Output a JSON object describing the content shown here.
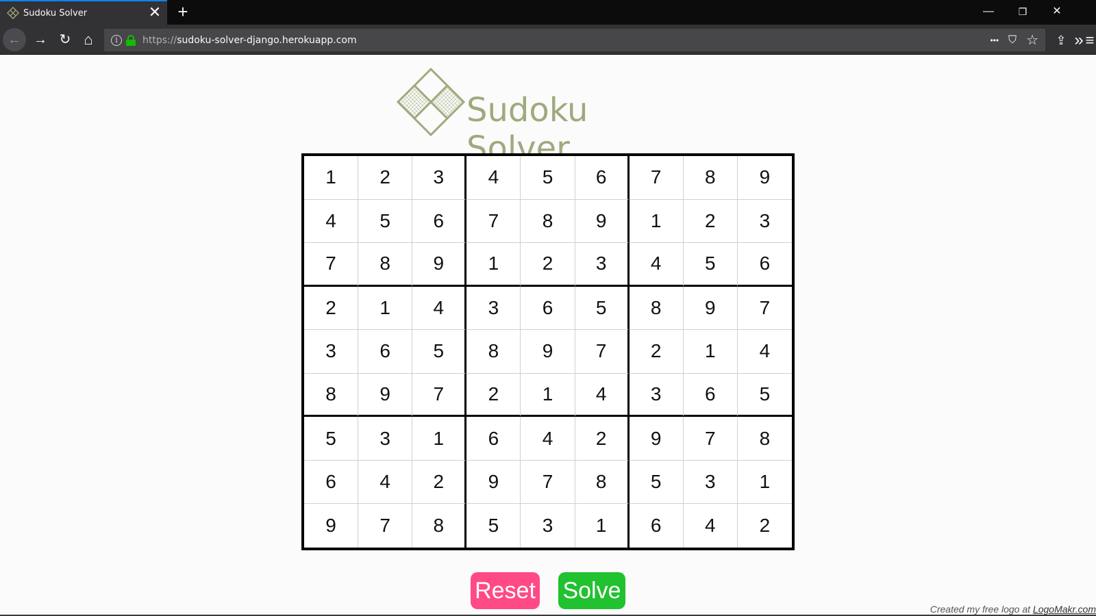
{
  "browser": {
    "tab_title": "Sudoku Solver",
    "tab_close": "✕",
    "new_tab": "+",
    "url_prefix": "https://",
    "url_host": "sudoku-solver-django.herokuapp.com",
    "window_controls": {
      "minimize": "—",
      "restore": "❐",
      "close": "✕"
    },
    "nav": {
      "back": "←",
      "forward": "→",
      "reload": "↻",
      "home": "⌂"
    },
    "url_icons": {
      "more": "•••",
      "pocket": "⛉",
      "bookmark": "☆"
    },
    "toolbar": {
      "library": "⇪",
      "overflow": "»",
      "menu": "≡"
    }
  },
  "page": {
    "logo_text": "Sudoku Solver",
    "grid": [
      [
        "1",
        "2",
        "3",
        "4",
        "5",
        "6",
        "7",
        "8",
        "9"
      ],
      [
        "4",
        "5",
        "6",
        "7",
        "8",
        "9",
        "1",
        "2",
        "3"
      ],
      [
        "7",
        "8",
        "9",
        "1",
        "2",
        "3",
        "4",
        "5",
        "6"
      ],
      [
        "2",
        "1",
        "4",
        "3",
        "6",
        "5",
        "8",
        "9",
        "7"
      ],
      [
        "3",
        "6",
        "5",
        "8",
        "9",
        "7",
        "2",
        "1",
        "4"
      ],
      [
        "8",
        "9",
        "7",
        "2",
        "1",
        "4",
        "3",
        "6",
        "5"
      ],
      [
        "5",
        "3",
        "1",
        "6",
        "4",
        "2",
        "9",
        "7",
        "8"
      ],
      [
        "6",
        "4",
        "2",
        "9",
        "7",
        "8",
        "5",
        "3",
        "1"
      ],
      [
        "9",
        "7",
        "8",
        "5",
        "3",
        "1",
        "6",
        "4",
        "2"
      ]
    ],
    "reset_label": "Reset",
    "solve_label": "Solve",
    "credit_text": "Created my free logo at ",
    "credit_link": "LogoMakr.com"
  },
  "colors": {
    "logo": "#9eaa7c",
    "reset": "#ff4a86",
    "solve": "#22c12f",
    "ssl_lock": "#12bc00",
    "tab_accent": "#0a84ff"
  }
}
